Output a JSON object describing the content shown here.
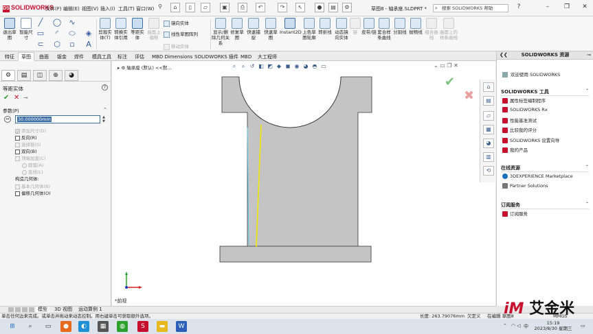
{
  "app": {
    "logo": "SOLIDWORKS",
    "doc_title": "草图8 - 轴承座.SLDPRT *"
  },
  "menu": [
    "文件(F)",
    "编辑(E)",
    "视图(V)",
    "插入(I)",
    "工具(T)",
    "窗口(W)"
  ],
  "search": {
    "placeholder": "搜索 SOLIDWORKS 帮助"
  },
  "ribbon": {
    "exit_sketch": "退出草图",
    "smart_dim": "智能尺寸",
    "trim": "剪裁实体(T)",
    "convert": "转换实体引用",
    "offset": "等距实体",
    "surface_offset": "曲面上偏移",
    "mirror": "镜向实体",
    "linear_pattern": "线性草图阵列",
    "move": "移动实体",
    "display_relations": "显示/删除几何关系",
    "repair": "修复草图",
    "quick_snap": "快速捕捉",
    "rapid_sketch": "快速草图",
    "instant2d": "Instant2D",
    "shaded": "上色草图轮廓",
    "lines_to_spline": "转折线",
    "dynamic_mirror": "动态镜向实体",
    "link": "链",
    "sheet_chain": "皮带/链",
    "spline_curve": "套合样条曲线",
    "split": "分割线",
    "project": "抛物线",
    "combine": "组合曲线",
    "face_curve": "曲面上的样条曲线"
  },
  "tabs": [
    "特征",
    "草图",
    "曲面",
    "钣金",
    "焊件",
    "模具工具",
    "标注",
    "评估",
    "MBD Dimensions",
    "SOLIDWORKS 插件",
    "MBD",
    "大工程师"
  ],
  "active_tab": "草图",
  "property_manager": {
    "title": "等距实体",
    "help": "?",
    "section": "参数(P)",
    "distance_value": "30.000000mm",
    "options": [
      {
        "label": "添加尺寸(D)",
        "checked": true,
        "enabled": false
      },
      {
        "label": "反向(R)",
        "checked": false,
        "enabled": true
      },
      {
        "label": "选择链(S)",
        "checked": false,
        "enabled": false
      },
      {
        "label": "双向(B)",
        "checked": false,
        "enabled": true
      },
      {
        "label": "顶端加盖(C)",
        "checked": false,
        "enabled": false
      }
    ],
    "radios": [
      "圆弧(A)",
      "直线(L)"
    ],
    "construction_label": "构造几何体:",
    "construction": [
      {
        "label": "基本几何体(B)",
        "checked": false,
        "enabled": false
      },
      {
        "label": "偏移几何体(O)",
        "checked": false,
        "enabled": true
      }
    ]
  },
  "viewport": {
    "breadcrumb": "轴承座 (默认) <<默...",
    "view_name": "*前视"
  },
  "task_pane": {
    "header": "SOLIDWORKS 资源",
    "welcome": "欢迎使用 SOLIDWORKS",
    "sections": [
      {
        "title": "SOLIDWORKS 工具",
        "items": [
          "属性标签编制程序",
          "SOLIDWORKS Rx",
          "性能基准测试",
          "比较我的评分",
          "SOLIDWORKS 设置向导",
          "我的产品"
        ]
      },
      {
        "title": "在线资源",
        "items": [
          "3DEXPERIENCE Marketplace",
          "Partner Solutions"
        ]
      },
      {
        "title": "订阅服务",
        "items": [
          "订阅服务"
        ]
      }
    ]
  },
  "bottom_tabs": [
    "模型",
    "3D 视图",
    "运动算例 1"
  ],
  "status": {
    "message": "单击任何边来完成。或单击并拖动来动态控制。用右键单击可获取额外选项。",
    "length": "长度: 263.79076mm",
    "state": "欠定义",
    "editing": "在编辑 草图8",
    "units": "MMGS"
  },
  "taskbar": {
    "time": "15:19",
    "date": "2023/8/30 星期三",
    "ime": "中"
  },
  "watermark": "艾金米",
  "colors": {
    "part_grey": "#c4c4c4",
    "sketch_yellow": "#f0e800",
    "offset_cyan": "#5bc8e8",
    "accent_red": "#c8102e"
  }
}
